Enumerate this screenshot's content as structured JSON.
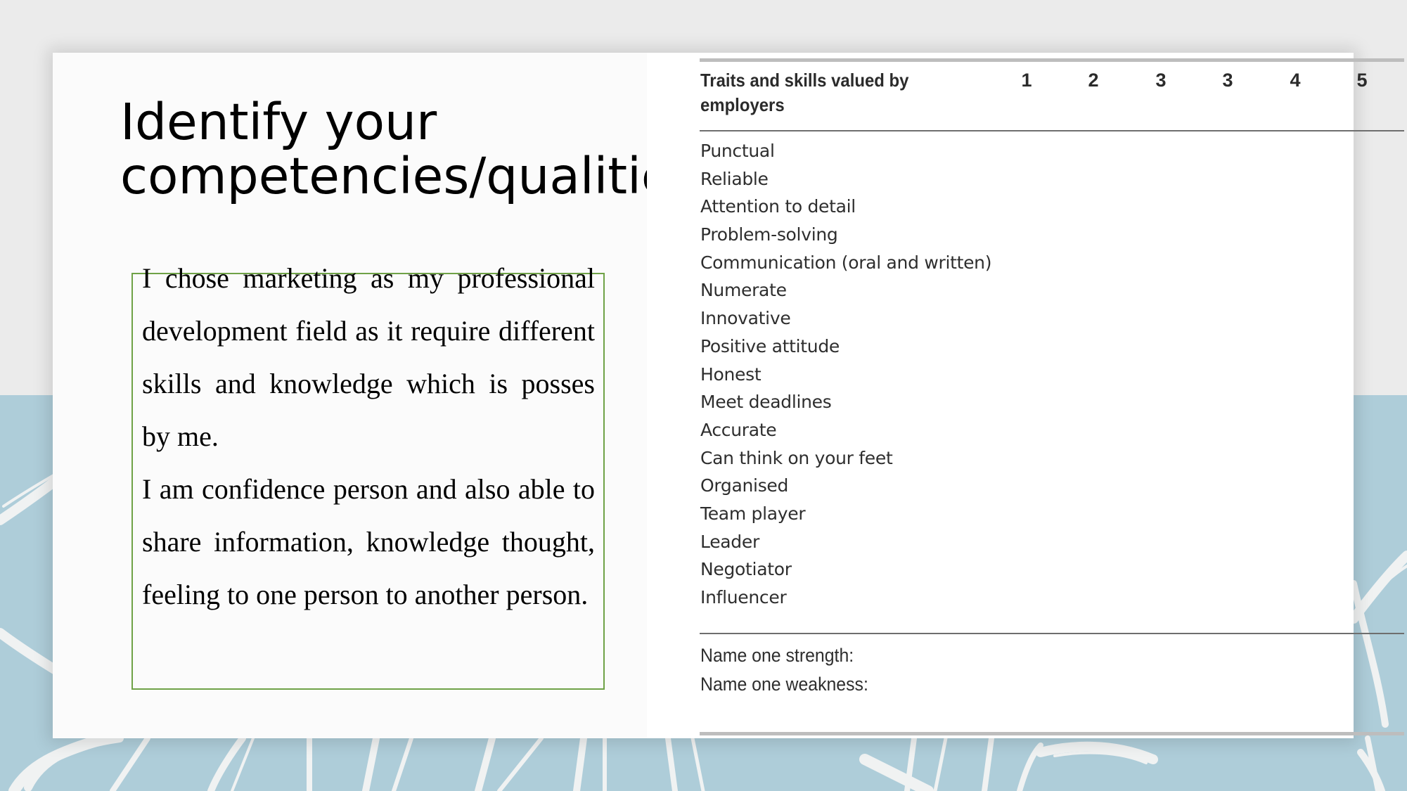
{
  "slide": {
    "title": "Identify your competencies/qualities",
    "body_paragraphs": [
      "I chose marketing as my professional development field as it require different skills and knowledge which is posses by me.",
      "I am confidence person and also able to share information, knowledge thought, feeling to one person to another person."
    ]
  },
  "table": {
    "header_label": "Traits and skills valued by employers",
    "rating_columns": [
      "1",
      "2",
      "3",
      "3",
      "4",
      "5"
    ],
    "traits": [
      "Punctual",
      "Reliable",
      "Attention to detail",
      "Problem-solving",
      "Communication (oral and written)",
      "Numerate",
      "Innovative",
      "Positive attitude",
      "Honest",
      "Meet deadlines",
      "Accurate",
      "Can think on your feet",
      "Organised",
      "Team player",
      "Leader",
      "Negotiator",
      "Influencer"
    ],
    "footer_prompts": [
      "Name one strength:",
      "Name one weakness:"
    ]
  },
  "colors": {
    "background_top": "#ebebeb",
    "background_bottom": "#aecdd9",
    "textbox_border": "#6fa247"
  }
}
